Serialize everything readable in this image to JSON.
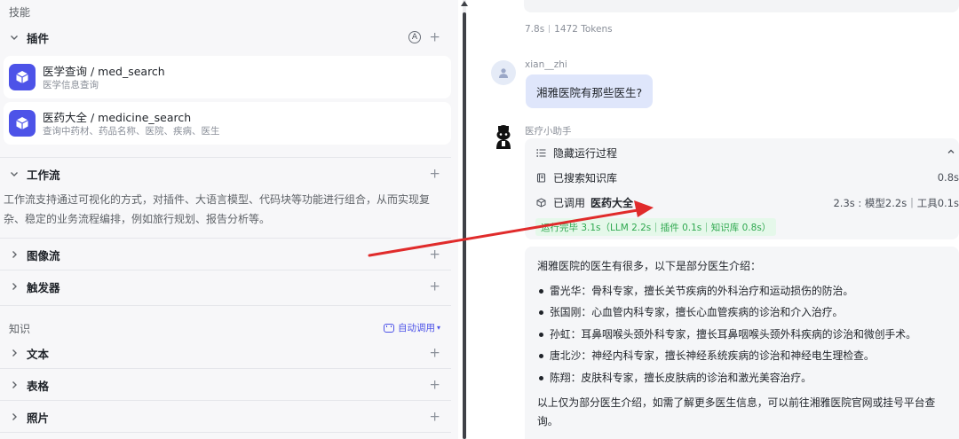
{
  "left": {
    "skills_label": "技能",
    "plugins": {
      "title": "插件",
      "auto_badge": "A",
      "add": "+",
      "items": [
        {
          "name": "医学查询 / med_search",
          "desc": "医学信息查询"
        },
        {
          "name": "医药大全 / medicine_search",
          "desc": "查询中药材、药品名称、医院、疾病、医生"
        }
      ]
    },
    "workflow": {
      "title": "工作流",
      "add": "+",
      "desc": "工作流支持通过可视化的方式，对插件、大语言模型、代码块等功能进行组合，从而实现复杂、稳定的业务流程编排，例如旅行规划、报告分析等。"
    },
    "imageflow": {
      "title": "图像流",
      "add": "+"
    },
    "trigger": {
      "title": "触发器",
      "add": "+"
    },
    "knowledge_label": "知识",
    "auto_call": "自动调用",
    "knowledge": [
      {
        "title": "文本",
        "add": "+"
      },
      {
        "title": "表格",
        "add": "+"
      },
      {
        "title": "照片",
        "add": "+"
      }
    ]
  },
  "right": {
    "prev_meta": {
      "time": "7.8s",
      "tokens": "1472 Tokens"
    },
    "user": {
      "name": "xian__zhi",
      "message": "湘雅医院有那些医生?"
    },
    "bot": {
      "name": "医疗小助手",
      "process": {
        "toggle_label": "隐藏运行过程",
        "kb_label": "已搜索知识库",
        "kb_time": "0.8s",
        "call_label": "已调用",
        "call_tool": "医药大全",
        "call_time": "2.3s : 模型2.2s｜工具0.1s",
        "done": "运行完毕 3.1s（LLM 2.2s｜插件 0.1s｜知识库 0.8s）"
      },
      "answer": {
        "intro": "湘雅医院的医生有很多，以下是部分医生介绍：",
        "items": [
          "雷光华：骨科专家，擅长关节疾病的外科治疗和运动损伤的防治。",
          "张国刚：心血管内科专家，擅长心血管疾病的诊治和介入治疗。",
          "孙虹：耳鼻咽喉头颈外科专家，擅长耳鼻咽喉头颈外科疾病的诊治和微创手术。",
          "唐北沙：神经内科专家，擅长神经系统疾病的诊治和神经电生理检查。",
          "陈翔：皮肤科专家，擅长皮肤病的诊治和激光美容治疗。"
        ],
        "outro": "以上仅为部分医生介绍，如需了解更多医生信息，可以前往湘雅医院官网或挂号平台查询。"
      }
    }
  },
  "colors": {
    "accent": "#4d53e8",
    "success": "#2fa84f",
    "annotation_arrow": "#e02b2b"
  },
  "icons": {
    "chevron": "chevron-icon",
    "plugin": "cube-icon",
    "auto": "auto-a-icon",
    "list": "list-icon",
    "book": "book-icon",
    "cube": "cube-icon",
    "caret_up": "caret-up-icon"
  }
}
